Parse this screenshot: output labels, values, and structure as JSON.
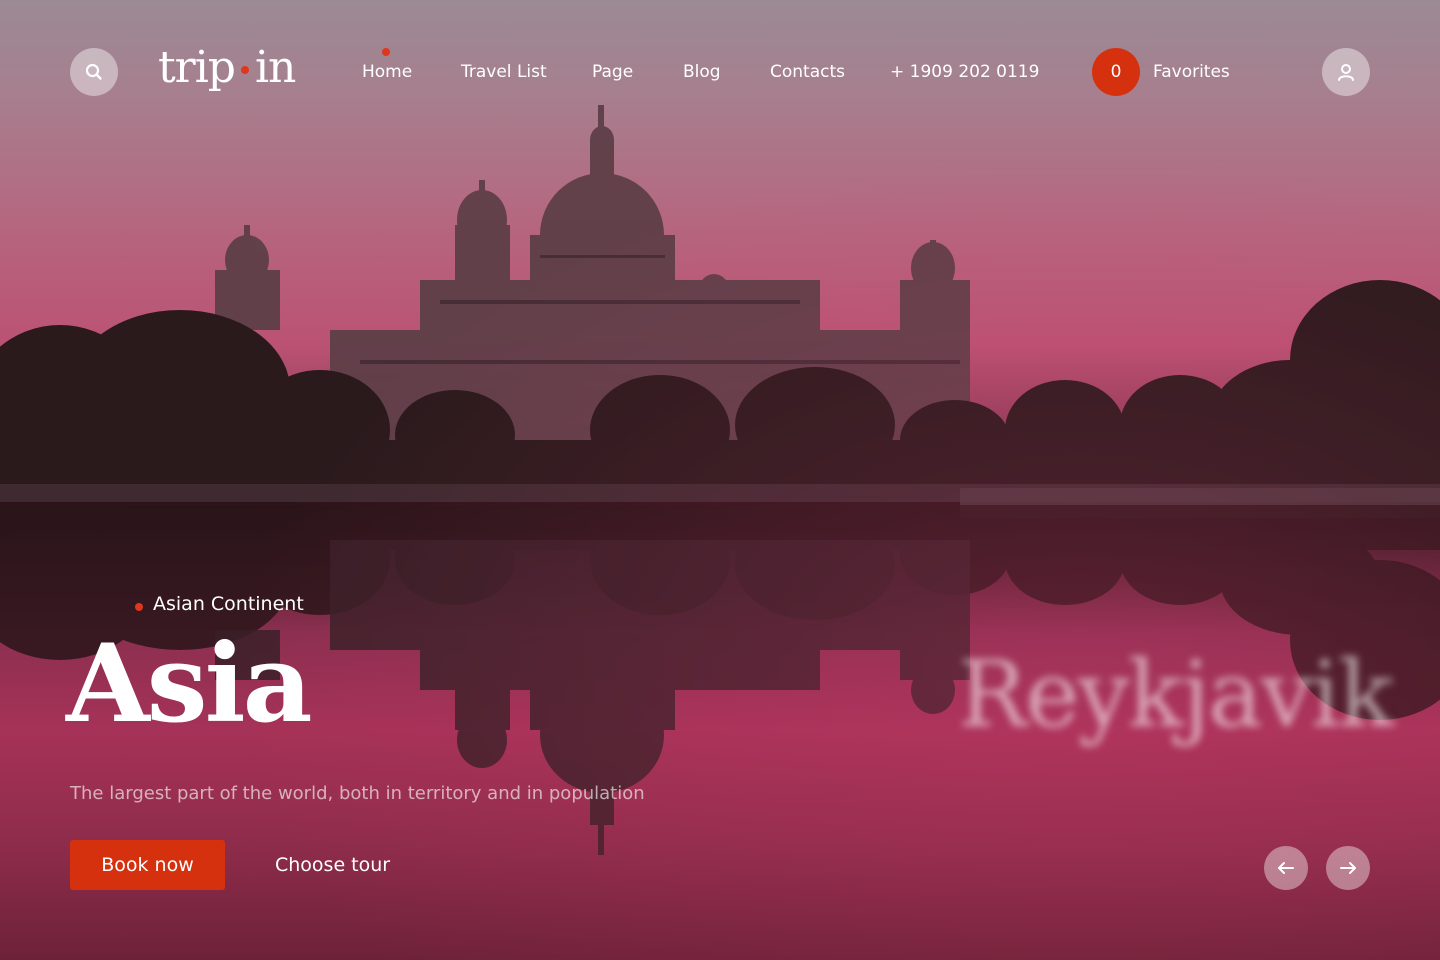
{
  "brand": {
    "logo_left": "trip",
    "logo_right": "in",
    "accent_color": "#d5310f"
  },
  "header": {
    "search_icon": "search-icon",
    "user_icon": "user-icon",
    "nav": [
      {
        "label": "Home",
        "active": true
      },
      {
        "label": "Travel List"
      },
      {
        "label": "Page"
      },
      {
        "label": "Blog"
      },
      {
        "label": "Contacts"
      },
      {
        "label": "+ 1909 202 0119"
      }
    ],
    "favorites_count": "0",
    "favorites_label": "Favorites"
  },
  "hero": {
    "eyebrow": "Asian Continent",
    "title": "Asia",
    "description": "The largest part of the world, both in territory and in population",
    "book_label": "Book now",
    "choose_label": "Choose tour",
    "next_destination": "Reykjavik",
    "prev_icon": "arrow-left-icon",
    "next_icon": "arrow-right-icon"
  }
}
